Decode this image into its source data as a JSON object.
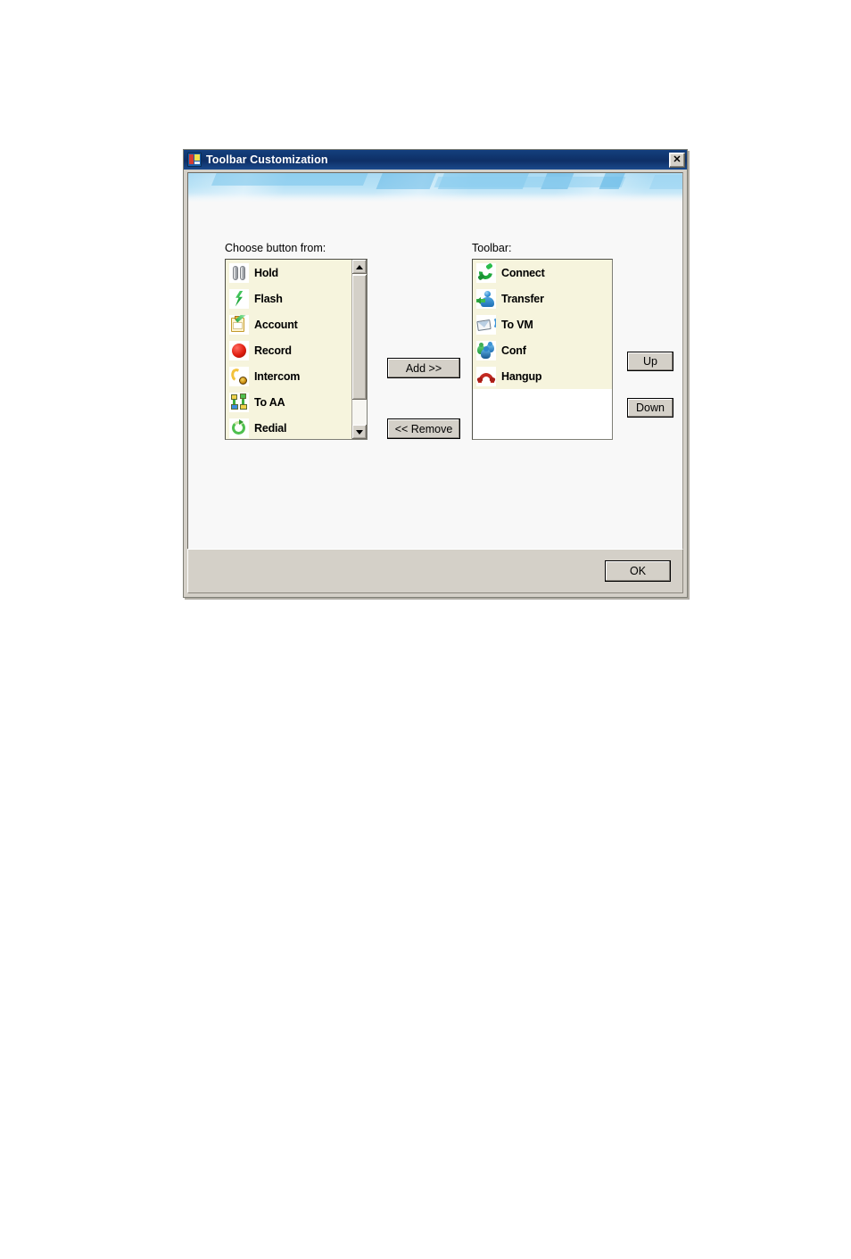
{
  "window": {
    "title": "Toolbar Customization",
    "title_icon": "app-window-icon",
    "close_label": "✕"
  },
  "panels": {
    "available_label": "Choose button from:",
    "toolbar_label": "Toolbar:"
  },
  "available_buttons": [
    {
      "label": "Hold",
      "icon": "hold-icon"
    },
    {
      "label": "Flash",
      "icon": "flash-icon"
    },
    {
      "label": "Account",
      "icon": "account-icon"
    },
    {
      "label": "Record",
      "icon": "record-icon"
    },
    {
      "label": "Intercom",
      "icon": "intercom-icon"
    },
    {
      "label": "To AA",
      "icon": "to-aa-icon"
    },
    {
      "label": "Redial",
      "icon": "redial-icon"
    }
  ],
  "toolbar_buttons": [
    {
      "label": "Connect",
      "icon": "connect-icon"
    },
    {
      "label": "Transfer",
      "icon": "transfer-icon"
    },
    {
      "label": "To VM",
      "icon": "to-vm-icon"
    },
    {
      "label": "Conf",
      "icon": "conf-icon"
    },
    {
      "label": "Hangup",
      "icon": "hangup-icon"
    }
  ],
  "actions": {
    "add": "Add >>",
    "remove": "<< Remove",
    "up": "Up",
    "down": "Down",
    "ok": "OK"
  },
  "colors": {
    "titlebar": "#0e2f66",
    "dialog_face": "#d4d0c8",
    "list_highlight": "#f6f4dd",
    "banner_blue": "#b8e2f6"
  }
}
